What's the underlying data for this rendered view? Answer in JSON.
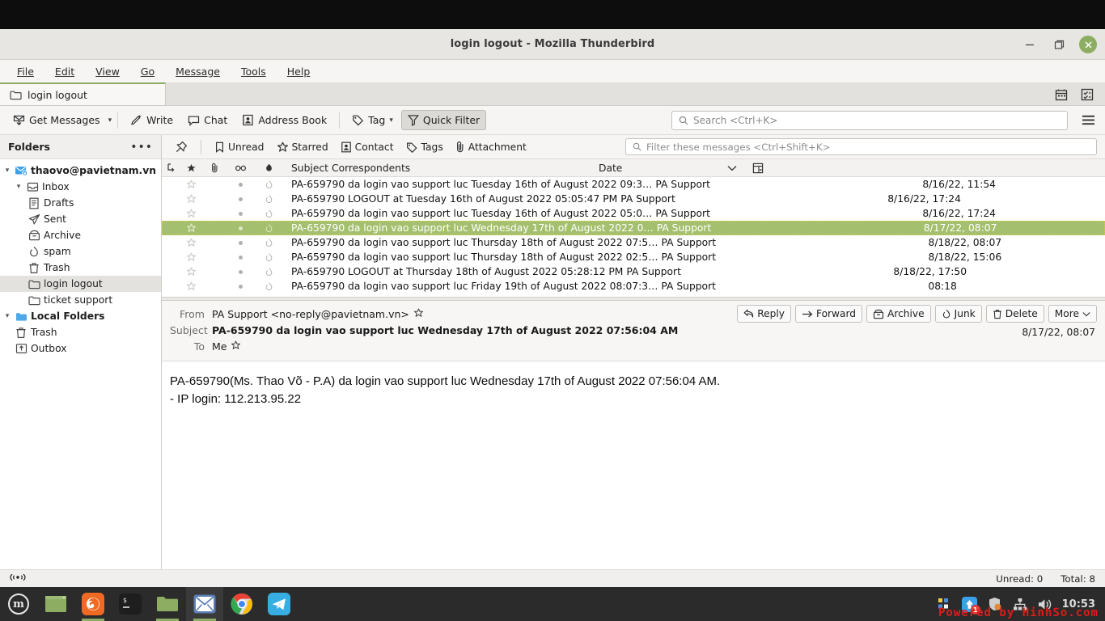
{
  "window": {
    "title": "login logout - Mozilla Thunderbird",
    "minimize_label": "Minimize",
    "maximize_label": "Restore",
    "close_label": "Close"
  },
  "menubar": {
    "items": [
      {
        "label": "File"
      },
      {
        "label": "Edit"
      },
      {
        "label": "View"
      },
      {
        "label": "Go"
      },
      {
        "label": "Message"
      },
      {
        "label": "Tools"
      },
      {
        "label": "Help"
      }
    ]
  },
  "tabs": {
    "active": {
      "label": "login logout",
      "icon": "folder-icon"
    },
    "right_icons": [
      {
        "name": "calendar-icon"
      },
      {
        "name": "tasks-icon"
      }
    ]
  },
  "toolbar": {
    "get_messages": "Get Messages",
    "write": "Write",
    "chat": "Chat",
    "address_book": "Address Book",
    "tag": "Tag",
    "quick_filter": "Quick Filter",
    "search_placeholder": "Search <Ctrl+K>",
    "menu_label": "Application Menu"
  },
  "quick_filter_bar": {
    "pin_label": "Pin",
    "buttons": [
      {
        "label": "Unread",
        "icon": "unread-icon"
      },
      {
        "label": "Starred",
        "icon": "star-icon"
      },
      {
        "label": "Contact",
        "icon": "contact-icon"
      },
      {
        "label": "Tags",
        "icon": "tag-icon"
      },
      {
        "label": "Attachment",
        "icon": "attachment-icon"
      }
    ],
    "filter_placeholder": "Filter these messages <Ctrl+Shift+K>"
  },
  "folders": {
    "header": "Folders",
    "more_label": "•••",
    "items": [
      {
        "label": "thaovo@pavietnam.vn",
        "icon": "account-icon",
        "depth": 0,
        "twisty": "down",
        "bold": true,
        "selected": false
      },
      {
        "label": "Inbox",
        "icon": "inbox-icon",
        "depth": 1,
        "twisty": "down",
        "bold": false,
        "selected": false
      },
      {
        "label": "Drafts",
        "icon": "drafts-icon",
        "depth": 2,
        "twisty": "",
        "bold": false,
        "selected": false
      },
      {
        "label": "Sent",
        "icon": "sent-icon",
        "depth": 2,
        "twisty": "",
        "bold": false,
        "selected": false
      },
      {
        "label": "Archive",
        "icon": "archive-icon",
        "depth": 2,
        "twisty": "",
        "bold": false,
        "selected": false
      },
      {
        "label": "spam",
        "icon": "junk-icon",
        "depth": 2,
        "twisty": "",
        "bold": false,
        "selected": false
      },
      {
        "label": "Trash",
        "icon": "trash-icon",
        "depth": 2,
        "twisty": "",
        "bold": false,
        "selected": false
      },
      {
        "label": "login logout",
        "icon": "folder-icon",
        "depth": 2,
        "twisty": "",
        "bold": false,
        "selected": true
      },
      {
        "label": "ticket support",
        "icon": "folder-icon",
        "depth": 2,
        "twisty": "",
        "bold": false,
        "selected": false
      },
      {
        "label": "Local Folders",
        "icon": "local-folder-icon",
        "depth": 0,
        "twisty": "down",
        "bold": true,
        "selected": false
      },
      {
        "label": "Trash",
        "icon": "trash-icon",
        "depth": 1,
        "twisty": "",
        "bold": false,
        "selected": false
      },
      {
        "label": "Outbox",
        "icon": "outbox-icon",
        "depth": 1,
        "twisty": "",
        "bold": false,
        "selected": false
      }
    ]
  },
  "message_list": {
    "columns": {
      "thread": "thread-icon",
      "star": "star-icon",
      "attachment": "attachment-icon",
      "read": "read-icon",
      "junk": "junk-icon",
      "subject": "Subject",
      "correspondents": "Correspondents",
      "date": "Date",
      "sort_indicator": "chevron-down-icon",
      "column_picker": "column-picker-icon"
    },
    "rows": [
      {
        "subject": "PA-659790 da login vao support luc Tuesday 16th of August 2022 09:3…",
        "correspondent": "PA Support",
        "date": "8/16/22, 11:54",
        "selected": false
      },
      {
        "subject": "PA-659790 LOGOUT at Tuesday 16th of August 2022 05:05:47 PM",
        "correspondent": "PA Support",
        "date": "8/16/22, 17:24",
        "selected": false
      },
      {
        "subject": "PA-659790 da login vao support luc Tuesday 16th of August 2022 05:0…",
        "correspondent": "PA Support",
        "date": "8/16/22, 17:24",
        "selected": false
      },
      {
        "subject": "PA-659790 da login vao support luc Wednesday 17th of August 2022 0…",
        "correspondent": "PA Support",
        "date": "8/17/22, 08:07",
        "selected": true
      },
      {
        "subject": "PA-659790 da login vao support luc Thursday 18th of August 2022 07:5…",
        "correspondent": "PA Support",
        "date": "8/18/22, 08:07",
        "selected": false
      },
      {
        "subject": "PA-659790 da login vao support luc Thursday 18th of August 2022 02:5…",
        "correspondent": "PA Support",
        "date": "8/18/22, 15:06",
        "selected": false
      },
      {
        "subject": "PA-659790 LOGOUT at Thursday 18th of August 2022 05:28:12 PM",
        "correspondent": "PA Support",
        "date": "8/18/22, 17:50",
        "selected": false
      },
      {
        "subject": "PA-659790 da login vao support luc Friday 19th of August 2022 08:07:3…",
        "correspondent": "PA Support",
        "date": "08:18",
        "selected": false
      }
    ]
  },
  "reader": {
    "from_label": "From",
    "from_value": "PA Support <no-reply@pavietnam.vn>",
    "subject_label": "Subject",
    "subject_value": "PA-659790 da login vao support luc Wednesday 17th of August 2022 07:56:04 AM",
    "to_label": "To",
    "to_value": "Me",
    "date": "8/17/22, 08:07",
    "actions": [
      {
        "label": "Reply",
        "icon": "reply-icon"
      },
      {
        "label": "Forward",
        "icon": "forward-icon"
      },
      {
        "label": "Archive",
        "icon": "archive-icon"
      },
      {
        "label": "Junk",
        "icon": "junk-icon"
      },
      {
        "label": "Delete",
        "icon": "trash-icon"
      },
      {
        "label": "More",
        "icon": "chevron-down-icon"
      }
    ],
    "body_line1": "PA-659790(Ms. Thao Võ - P.A) da login vao support luc Wednesday 17th of August 2022 07:56:04 AM.",
    "body_line2": "- IP login: 112.213.95.22"
  },
  "statusbar": {
    "connection_icon": "broadcast-icon",
    "unread": "Unread: 0",
    "total": "Total: 8"
  },
  "taskbar": {
    "menu_label": "Menu",
    "apps": [
      {
        "name": "show-desktop-icon"
      },
      {
        "name": "firefox-icon"
      },
      {
        "name": "terminal-icon"
      },
      {
        "name": "files-icon"
      },
      {
        "name": "thunderbird-icon"
      },
      {
        "name": "chrome-icon"
      },
      {
        "name": "telegram-icon"
      }
    ],
    "tray": [
      {
        "name": "keyboard-layout-icon"
      },
      {
        "name": "updates-icon",
        "badge": "1"
      },
      {
        "name": "shield-icon"
      },
      {
        "name": "network-icon"
      },
      {
        "name": "volume-icon"
      }
    ],
    "clock": "10:53",
    "watermark": "Powered by HinhSo.com"
  },
  "colors": {
    "selection_green": "#a4c06e",
    "tab_accent": "#8dae62",
    "watermark_red": "#e01b1b"
  }
}
